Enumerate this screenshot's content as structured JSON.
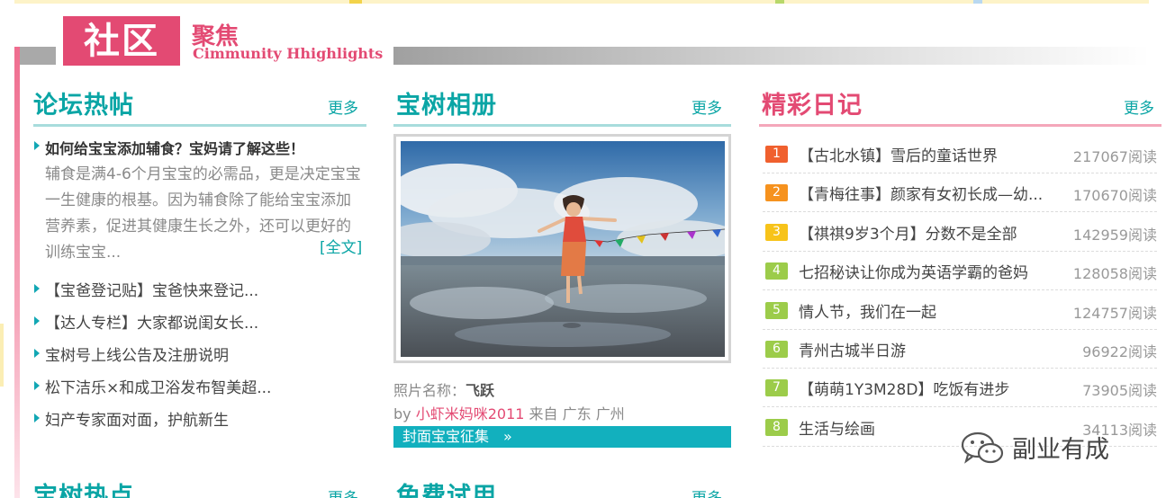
{
  "header": {
    "title": "社区",
    "subtitle_cn": "聚焦",
    "subtitle_en": "Cimmunity Hhighlights"
  },
  "forum": {
    "title": "论坛热帖",
    "more": "更多",
    "featured_title": "如何给宝宝添加辅食？宝妈请了解这些！",
    "featured_body": "辅食是满4-6个月宝宝的必需品，更是决定宝宝一生健康的根基。因为辅食除了能给宝宝添加营养素，促进其健康生长之外，还可以更好的训练宝宝...",
    "full_text": "[全文]",
    "items": [
      "【宝爸登记贴】宝爸快来登记...",
      "【达人专栏】大家都说闺女长...",
      "宝树号上线公告及注册说明",
      "松下洁乐×和成卫浴发布智美超...",
      "妇产专家面对面，护航新生"
    ]
  },
  "album": {
    "title": "宝树相册",
    "more": "更多",
    "photo_label": "照片名称：",
    "photo_name": "飞跃",
    "by": "by",
    "user": "小虾米妈咪2011",
    "from": "来自 广东 广州",
    "cover_link": "封面宝宝征集　»"
  },
  "diary": {
    "title": "精彩日记",
    "more": "更多",
    "items": [
      {
        "rank": "1",
        "title": "【古北水镇】雪后的童话世界",
        "count": "217067阅读",
        "color": "#f0602e"
      },
      {
        "rank": "2",
        "title": "【青梅往事】颜家有女初长成—幼...",
        "count": "170670阅读",
        "color": "#f6921e"
      },
      {
        "rank": "3",
        "title": "【祺祺9岁3个月】分数不是全部",
        "count": "142959阅读",
        "color": "#f7c31a"
      },
      {
        "rank": "4",
        "title": "七招秘诀让你成为英语学霸的爸妈",
        "count": "128058阅读",
        "color": "#9ccc4a"
      },
      {
        "rank": "5",
        "title": "情人节，我们在一起",
        "count": "124757阅读",
        "color": "#9ccc4a"
      },
      {
        "rank": "6",
        "title": "青州古城半日游",
        "count": "96922阅读",
        "color": "#9ccc4a"
      },
      {
        "rank": "7",
        "title": "【萌萌1Y3M28D】吃饭有进步",
        "count": "73905阅读",
        "color": "#9ccc4a"
      },
      {
        "rank": "8",
        "title": "生活与绘画",
        "count": "34113阅读",
        "color": "#9ccc4a"
      }
    ]
  },
  "bottom": {
    "hot_title": "宝树热点",
    "hot_more": "更多",
    "trial_title": "免费试用",
    "trial_more": "更多"
  },
  "watermark": "副业有成",
  "colors": {
    "brand_pink": "#e34a73",
    "teal": "#0aa5a5",
    "cover_bar": "#12b0be"
  }
}
